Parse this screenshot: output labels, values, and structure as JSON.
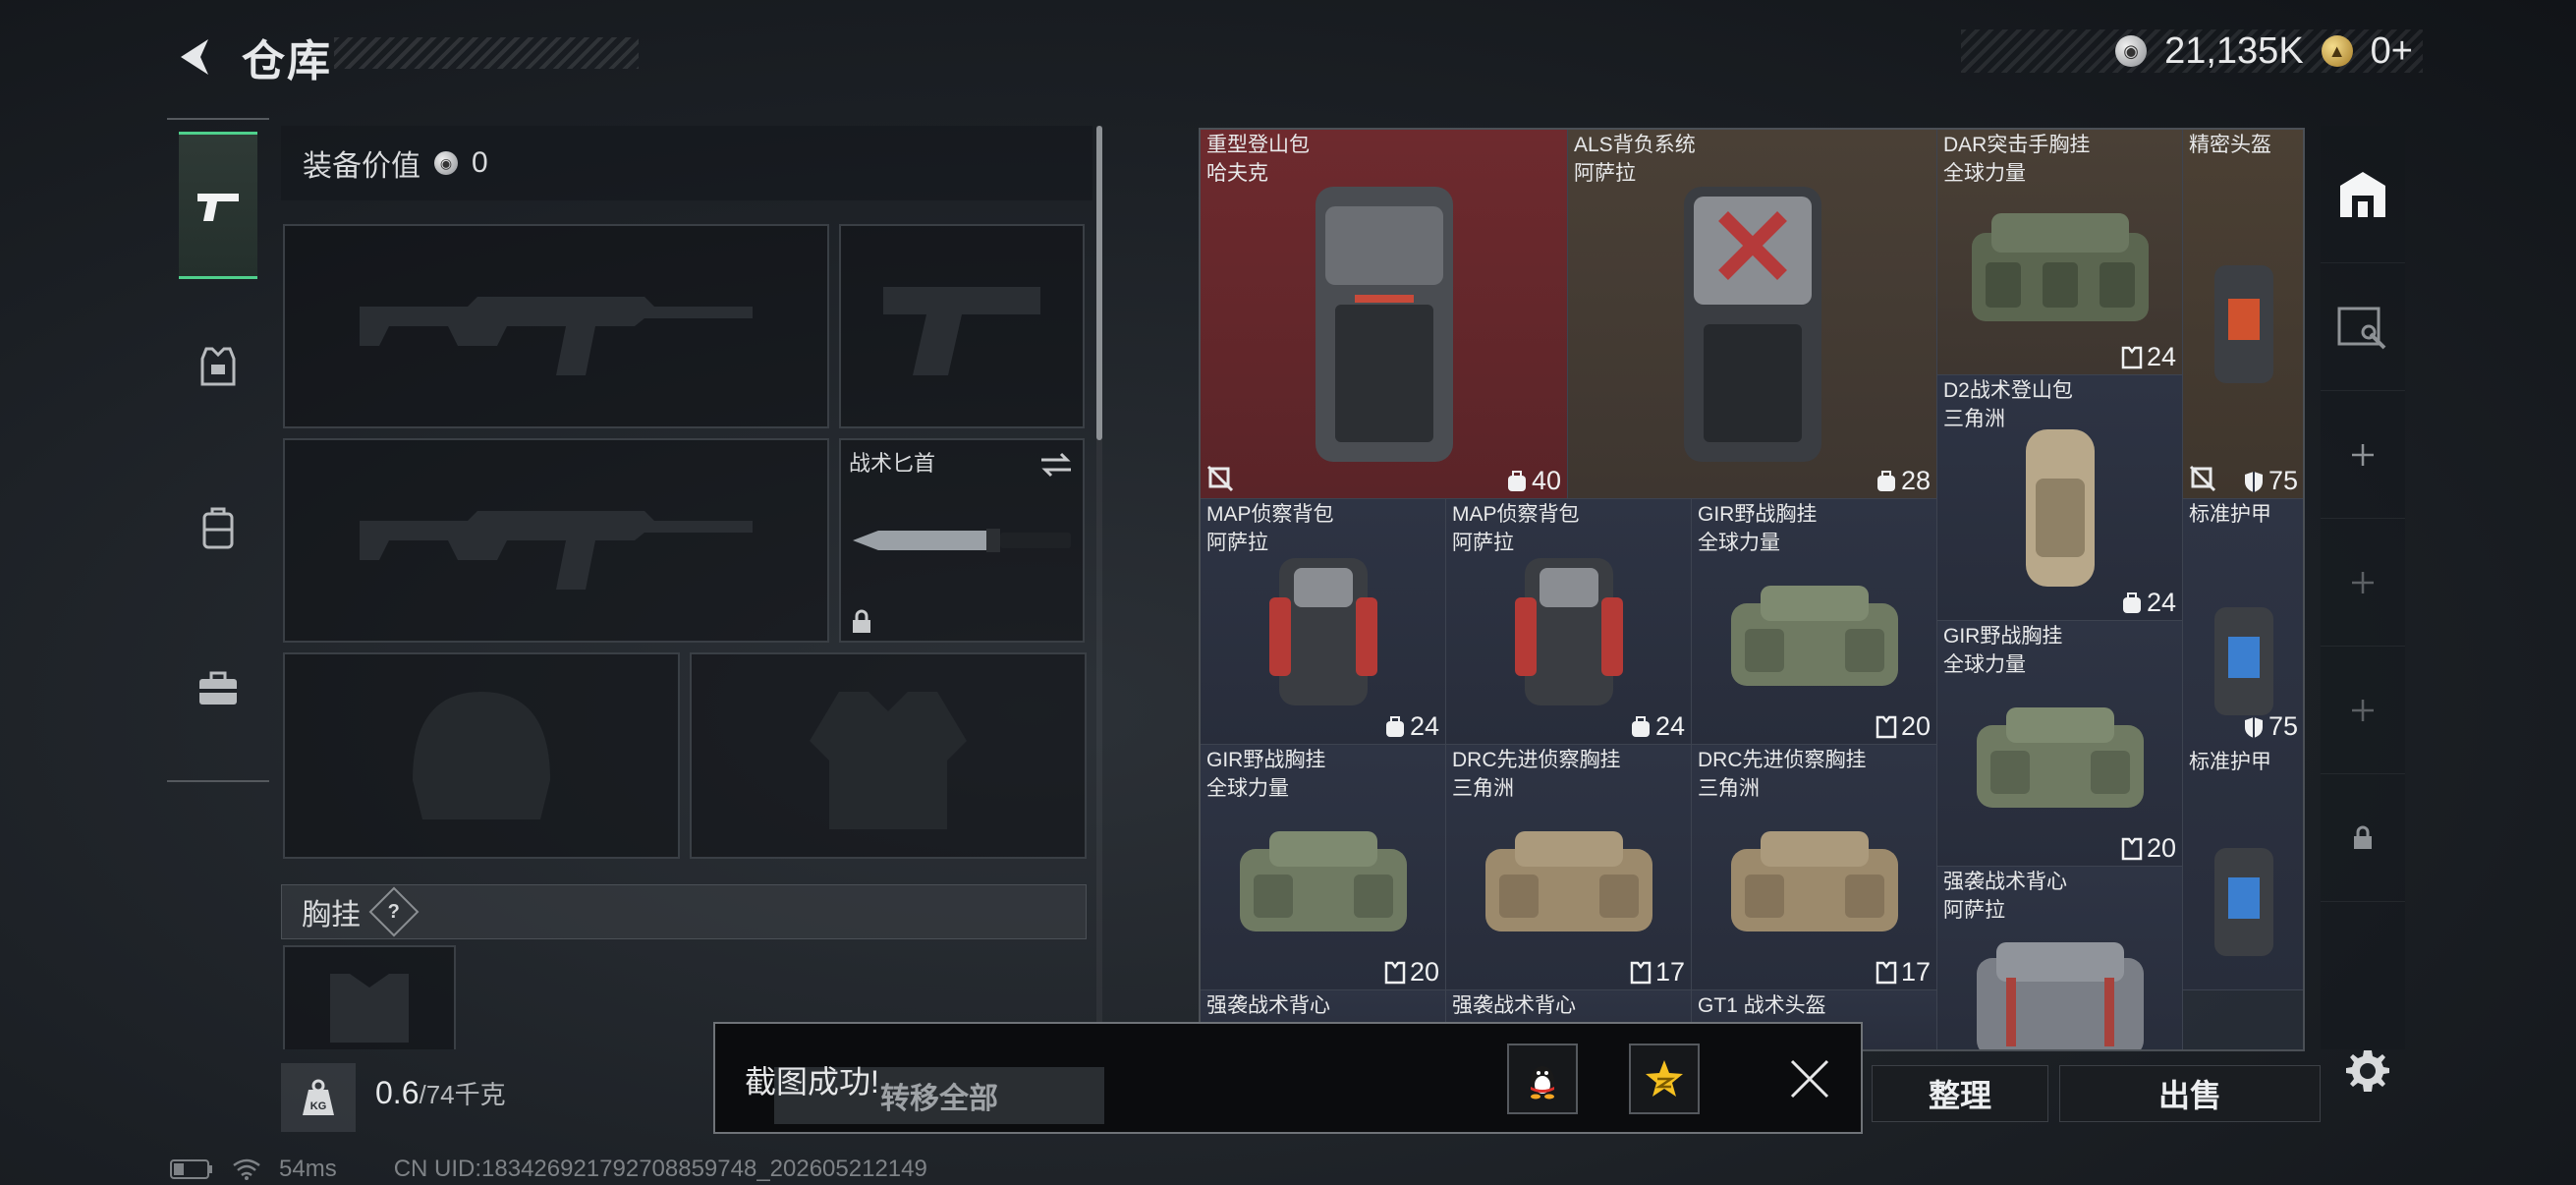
{
  "header": {
    "title": "仓库",
    "currencies": [
      {
        "icon": "silver-coin-icon",
        "value": "21,135K"
      },
      {
        "icon": "gold-coin-icon",
        "value": "0+"
      }
    ]
  },
  "equipment": {
    "value_label": "装备价值",
    "value": "0",
    "knife_label": "战术匕首",
    "vest_label": "胸挂",
    "help": "?"
  },
  "weight": {
    "icon_text": "KG",
    "current": "0.6",
    "max": "/74千克"
  },
  "inventory": {
    "items": [
      {
        "name": "重型登山包",
        "sub": "哈夫克",
        "cap": "40",
        "cap_icon": "backpack-capacity-icon",
        "color": "red"
      },
      {
        "name": "ALS背负系统",
        "sub": "阿萨拉",
        "cap": "28",
        "cap_icon": "backpack-capacity-icon",
        "color": "tan"
      },
      {
        "name": "DAR突击手胸挂",
        "sub": "全球力量",
        "cap": "24",
        "cap_icon": "vest-capacity-icon",
        "color": "tan"
      },
      {
        "name": "精密头盔",
        "sub": "",
        "cap": "75",
        "cap_icon": "armor-shield-icon",
        "color": "gold"
      },
      {
        "name": "D2战术登山包",
        "sub": "三角洲",
        "cap": "24",
        "cap_icon": "backpack-capacity-icon",
        "color": "blue"
      },
      {
        "name": "MAP侦察背包",
        "sub": "阿萨拉",
        "cap": "24",
        "cap_icon": "backpack-capacity-icon",
        "color": "blue"
      },
      {
        "name": "MAP侦察背包",
        "sub": "阿萨拉",
        "cap": "24",
        "cap_icon": "backpack-capacity-icon",
        "color": "blue"
      },
      {
        "name": "GIR野战胸挂",
        "sub": "全球力量",
        "cap": "20",
        "cap_icon": "vest-capacity-icon",
        "color": "blue"
      },
      {
        "name": "标准护甲",
        "sub": "",
        "cap": "75",
        "cap_icon": "armor-shield-icon",
        "color": "blue"
      },
      {
        "name": "GIR野战胸挂",
        "sub": "全球力量",
        "cap": "20",
        "cap_icon": "vest-capacity-icon",
        "color": "blue"
      },
      {
        "name": "GIR野战胸挂",
        "sub": "全球力量",
        "cap": "20",
        "cap_icon": "vest-capacity-icon",
        "color": "blue"
      },
      {
        "name": "DRC先进侦察胸挂",
        "sub": "三角洲",
        "cap": "17",
        "cap_icon": "vest-capacity-icon",
        "color": "blue"
      },
      {
        "name": "DRC先进侦察胸挂",
        "sub": "三角洲",
        "cap": "17",
        "cap_icon": "vest-capacity-icon",
        "color": "blue"
      },
      {
        "name": "强袭战术背心",
        "sub": "阿萨拉",
        "cap": "",
        "cap_icon": "",
        "color": "blue"
      },
      {
        "name": "标准护甲",
        "sub": "",
        "cap": "",
        "cap_icon": "",
        "color": "blue"
      },
      {
        "name": "强袭战术背心",
        "sub": "",
        "cap": "",
        "cap_icon": "",
        "color": "blue"
      },
      {
        "name": "强袭战术背心",
        "sub": "",
        "cap": "",
        "cap_icon": "",
        "color": "blue"
      },
      {
        "name": "GT1 战术头盔",
        "sub": "",
        "cap": "",
        "cap_icon": "",
        "color": "blue"
      }
    ]
  },
  "buttons": {
    "transfer_all": "转移全部",
    "sort": "整理",
    "sell": "出售"
  },
  "toast": {
    "message": "截图成功!"
  },
  "status": {
    "ping": "54ms",
    "uid": "CN UID:183426921792708859748_202605212149"
  },
  "colors": {
    "accent_green": "#4fd08c",
    "item_red": "#6e2a2e",
    "item_tan": "#4a4036",
    "item_blue": "#2e3444"
  }
}
